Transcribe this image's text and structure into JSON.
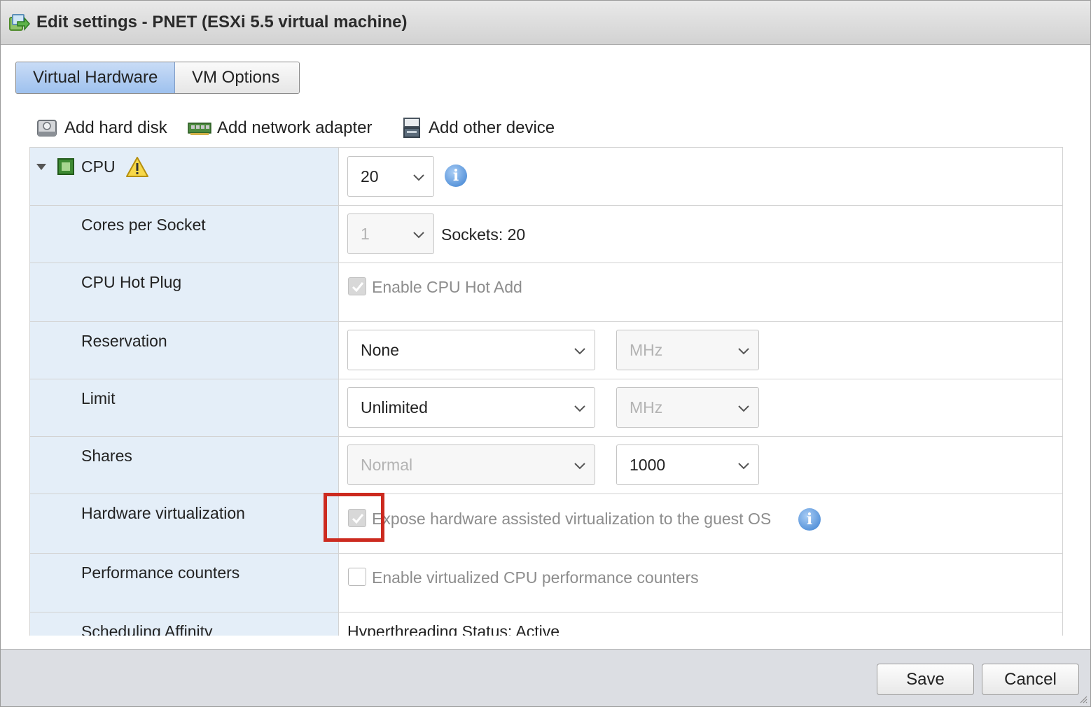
{
  "window": {
    "title": "Edit settings - PNET (ESXi 5.5 virtual machine)",
    "icon": "edit-vm-icon"
  },
  "tabs": [
    {
      "label": "Virtual Hardware",
      "active": true
    },
    {
      "label": "VM Options",
      "active": false
    }
  ],
  "toolbar": {
    "add_hard_disk": "Add hard disk",
    "add_network_adapter": "Add network adapter",
    "add_other_device": "Add other device"
  },
  "cpu": {
    "label": "CPU",
    "count_value": "20",
    "cores_per_socket": {
      "label": "Cores per Socket",
      "value": "1",
      "sockets_text": "Sockets: 20"
    },
    "hot_plug": {
      "label": "CPU Hot Plug",
      "checkbox_label": "Enable CPU Hot Add",
      "checked": true
    },
    "reservation": {
      "label": "Reservation",
      "value": "None",
      "unit": "MHz"
    },
    "limit": {
      "label": "Limit",
      "value": "Unlimited",
      "unit": "MHz"
    },
    "shares": {
      "label": "Shares",
      "value": "Normal",
      "amount": "1000"
    },
    "hw_virtualization": {
      "label": "Hardware virtualization",
      "checkbox_label": "Expose hardware assisted virtualization to the guest OS",
      "checked": true
    },
    "perf_counters": {
      "label": "Performance counters",
      "checkbox_label": "Enable virtualized CPU performance counters",
      "checked": false
    },
    "scheduling_affinity": {
      "label": "Scheduling Affinity",
      "value": "Hyperthreading Status: Active"
    }
  },
  "footer": {
    "save_label": "Save",
    "cancel_label": "Cancel"
  },
  "colors": {
    "highlight": "#cc2a1f",
    "left_column": "#e4eef8",
    "active_tab": "#9ec1ee"
  }
}
